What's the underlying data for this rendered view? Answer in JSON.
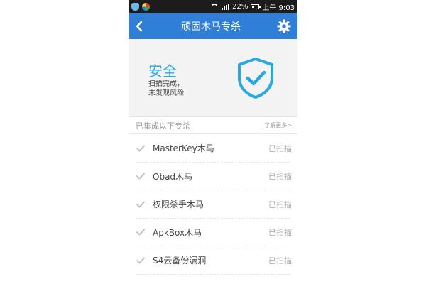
{
  "status_bar": {
    "battery": "22%",
    "time": "上午 9:03"
  },
  "header": {
    "title": "顽固木马专杀"
  },
  "status_panel": {
    "title": "安全",
    "desc_line1": "扫描完成，",
    "desc_line2": "未发现风险"
  },
  "section": {
    "title": "已集成以下专杀",
    "link": "了解更多>"
  },
  "items": [
    {
      "name": "MasterKey木马",
      "status": "已扫描"
    },
    {
      "name": "Obad木马",
      "status": "已扫描"
    },
    {
      "name": "权限杀手木马",
      "status": "已扫描"
    },
    {
      "name": "ApkBox木马",
      "status": "已扫描"
    },
    {
      "name": "S4云备份漏洞",
      "status": "已扫描"
    }
  ],
  "colors": {
    "header": "#2f7ed8",
    "accent": "#29a8df"
  },
  "icons": [
    "shield-icon",
    "circle-app-icon",
    "wifi-icon",
    "signal-icon",
    "battery-icon",
    "back-icon",
    "gear-icon",
    "shield-check-icon",
    "check-icon"
  ]
}
